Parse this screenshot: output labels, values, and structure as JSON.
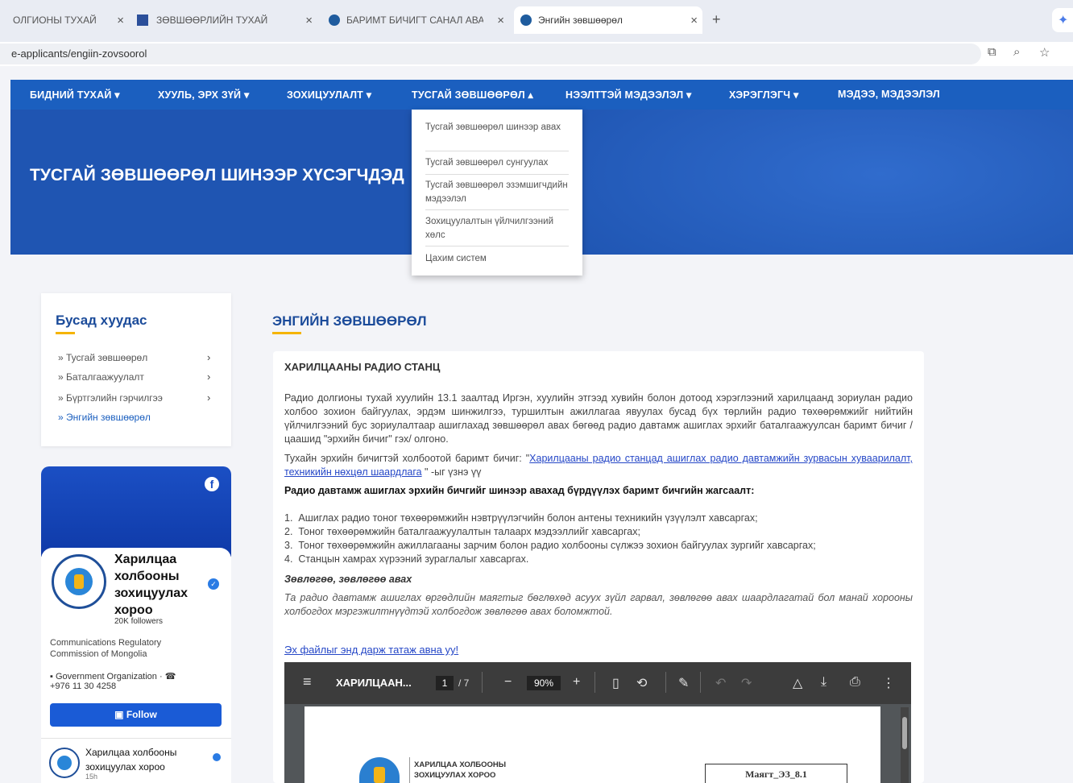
{
  "browser": {
    "tabs": [
      {
        "title": "ОЛГИОНЫ ТУХАЙ"
      },
      {
        "title": "ЗӨВШӨӨРЛИЙН ТУХАЙ"
      },
      {
        "title": "БАРИМТ БИЧИГТ САНАЛ АВАХ"
      },
      {
        "title": "Энгийн зөвшөөрөл"
      }
    ],
    "new_tab": "+",
    "address": "e-applicants/engiin-zovsoorol"
  },
  "nav": {
    "items": [
      "БИДНИЙ ТУХАЙ",
      "ХУУЛЬ, ЭРХ ЗҮЙ",
      "ЗОХИЦУУЛАЛТ",
      "ТУСГАЙ ЗӨВШӨӨРӨЛ",
      "НЭЭЛТТЭЙ МЭДЭЭЛЭЛ",
      "ХЭРЭГЛЭГЧ",
      "МЭДЭЭ, МЭДЭЭЛЭЛ"
    ],
    "dropdown": [
      "Тусгай зөвшөөрөл шинээр авах",
      "Тусгай зөвшөөрөл сунгуулах",
      "Тусгай зөвшөөрөл эзэмшигчдийн мэдээлэл",
      "Зохицуулалтын үйлчилгээний хөлс",
      "Цахим систем"
    ]
  },
  "hero": {
    "title": "ТУСГАЙ ЗӨВШӨӨРӨЛ ШИНЭЭР ХҮСЭГЧДЭД"
  },
  "sidebar": {
    "title": "Бусад хуудас",
    "items": [
      {
        "label": "Тусгай зөвшөөрөл"
      },
      {
        "label": "Баталгаажуулалт"
      },
      {
        "label": "Бүртгэлийн гэрчилгээ"
      },
      {
        "label": "Энгийн зөвшөөрөл"
      }
    ]
  },
  "facebook": {
    "name": "Харилцаа холбооны зохицуулах хороо",
    "followers": "20K followers",
    "description": "Communications Regulatory Commission of Mongolia",
    "category": "Government Organization ·",
    "phone": "+976 11 30 4258",
    "follow_label": "Follow",
    "post_author": "Харилцаа холбооны зохицуулах хороо",
    "post_time": "15h"
  },
  "main": {
    "title": "ЭНГИЙН ЗӨВШӨӨРӨЛ",
    "section_title": "ХАРИЛЦААНЫ РАДИО СТАНЦ",
    "paragraph1": "Радио долгионы тухай хуулийн 13.1 заалтад Иргэн, хуулийн этгээд хувийн болон дотоод хэрэглээний харилцаанд зориулан радио холбоо зохион байгуулах, эрдэм шинжилгээ, туршилтын ажиллагаа явуулах бусад бүх төрлийн радио төхөөрөмжийг нийтийн үйлчилгээний бус зориулалтаар ашиглахад зөвшөөрөл авах бөгөөд радио давтамж ашиглах эрхийг баталгаажуулсан баримт бичиг /цаашид \"эрхийн бичиг\" гэх/ олгоно.",
    "paragraph2_pre": "Тухайн эрхийн бичигтэй холбоотой баримт бичиг: \"",
    "paragraph2_link": "Харилцааны радио станцад ашиглах радио давтамжийн зурвасын хуваарилалт, техникийн нөхцөл шаардлага",
    "paragraph2_post": " \" -ыг үзнэ үү",
    "bold_heading": "Радио давтамж ашиглах эрхийн бичгийг шинээр авахад бүрдүүлэх баримт бичгийн жагсаалт:",
    "list": [
      "Ашиглах радио тоног төхөөрөмжийн нэвтрүүлэгчийн болон антены техникийн үзүүлэлт хавсаргах;",
      "Тоног төхөөрөмжийн баталгаажуулалтын талаарх мэдээллийг хавсаргах;",
      "Тоног төхөөрөмжийн ажиллагааны зарчим болон радио холбооны сүлжээ зохион байгуулах зургийг хавсаргах;",
      "Станцын хамрах хүрээний зураглалыг хавсаргах."
    ],
    "qa_heading": "Зөвлөгөө, зөвлөгөө авах",
    "qa_text": "Та радио давтамж ашиглах өргөдлийн маягтыг бөглөхөд асуух зүйл гарвал, зөвлөгөө авах шаардлагатай бол манай хорооны холбогдох мэргэжилтнүүдтэй холбогдож зөвлөгөө авах боломжтой.",
    "download_link": "Эх файлыг энд дарж татаж авна уу!"
  },
  "pdf": {
    "title": "ХАРИЛЦААН...",
    "page_current": "1",
    "page_total": "/ 7",
    "zoom": "90%",
    "doc_org": "ХАРИЛЦАА ХОЛБООНЫ ЗОХИЦУУЛАХ ХОРОО",
    "form_code": "Маягт_ЭЗ_8.1"
  }
}
